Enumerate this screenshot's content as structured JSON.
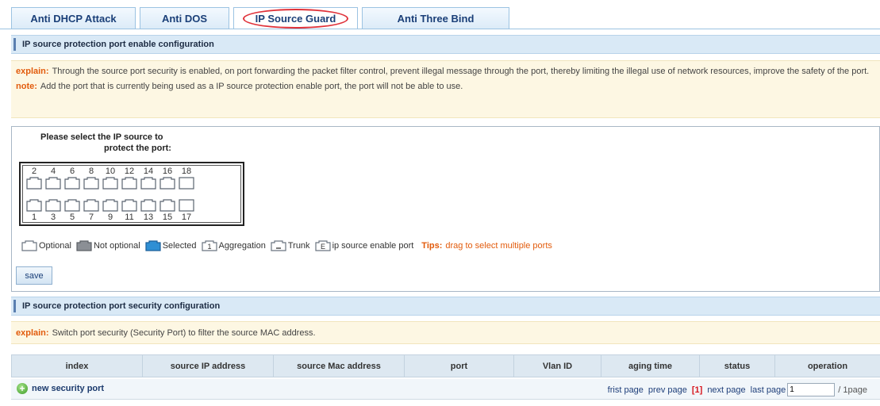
{
  "tabs": [
    {
      "label": "Anti DHCP Attack",
      "active": false
    },
    {
      "label": "Anti DOS",
      "active": false
    },
    {
      "label": "IP Source Guard",
      "active": true
    },
    {
      "label": "Anti Three Bind",
      "active": false
    }
  ],
  "section1": {
    "title": "IP source protection port enable configuration",
    "explain_label": "explain:",
    "explain_text": "Through the source port security is enabled, on port forwarding the packet filter control, prevent illegal message through the port, thereby limiting the illegal use of network resources, improve the safety of the port.",
    "note_label": "note:",
    "note_text": "Add the port that is currently being used as a IP source protection enable port, the port will not be able to use."
  },
  "port_panel": {
    "prompt_line1": "Please select the IP source to",
    "prompt_line2": "protect the port:",
    "top_ports": [
      "2",
      "4",
      "6",
      "8",
      "10",
      "12",
      "14",
      "16",
      "18"
    ],
    "bottom_ports": [
      "1",
      "3",
      "5",
      "7",
      "9",
      "11",
      "13",
      "15",
      "17"
    ],
    "legend": {
      "optional": "Optional",
      "not_optional": "Not optional",
      "selected": "Selected",
      "aggregation": "Aggregation",
      "aggregation_glyph": "1",
      "trunk": "Trunk",
      "ip_source": "ip source enable port",
      "ip_source_glyph": "E",
      "tips_label": "Tips:",
      "tips_text": "drag to select multiple ports"
    },
    "save_label": "save"
  },
  "section2": {
    "title": "IP source protection port security configuration",
    "explain_label": "explain:",
    "explain_text": "Switch port security (Security Port) to filter the source MAC address."
  },
  "table": {
    "columns": [
      "index",
      "source IP address",
      "source Mac address",
      "port",
      "Vlan ID",
      "aging time",
      "status",
      "operation"
    ]
  },
  "footer": {
    "new_label": "new security port",
    "first": "frist page",
    "prev": "prev page",
    "current": "[1]",
    "next": "next page",
    "last": "last page",
    "page_input": "1",
    "total": "/ 1page"
  },
  "colors": {
    "accent_orange": "#e25b0c",
    "tab_text": "#1a3f78",
    "active_tab_circle": "#e0323a",
    "current_page": "#d7171f"
  }
}
